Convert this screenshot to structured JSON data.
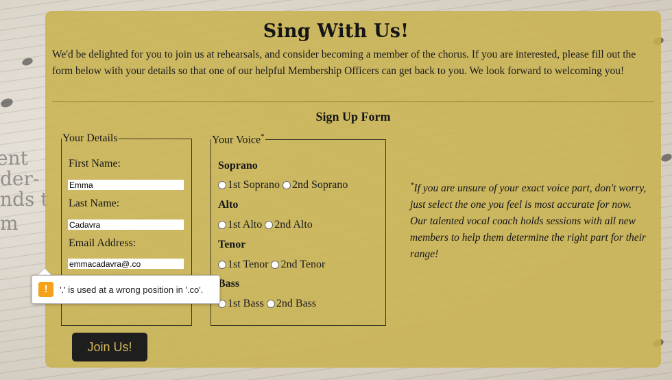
{
  "page": {
    "title": "Sing With Us!",
    "intro": "We'd be delighted for you to join us at rehearsals, and consider becoming a member of the chorus. If you are interested, please fill out the form below with your details so that one of our helpful Membership Officers can get back to you. We look forward to welcoming you!"
  },
  "form": {
    "title": "Sign Up Form",
    "details_legend": "Your Details",
    "first_name_label": "First Name:",
    "first_name_value": "Emma",
    "last_name_label": "Last Name:",
    "last_name_value": "Cadavra",
    "email_label": "Email Address:",
    "email_value": "emmacadavra@.co",
    "voice_legend": "Your Voice",
    "voice_asterisk": "*",
    "groups": [
      {
        "label": "Soprano",
        "options": [
          "1st Soprano",
          "2nd Soprano"
        ]
      },
      {
        "label": "Alto",
        "options": [
          "1st Alto",
          "2nd Alto"
        ]
      },
      {
        "label": "Tenor",
        "options": [
          "1st Tenor",
          "2nd Tenor"
        ]
      },
      {
        "label": "Bass",
        "options": [
          "1st Bass",
          "2nd Bass"
        ]
      }
    ],
    "note_asterisk": "*",
    "note": "If you are unsure of your exact voice part, don't worry, just select the one you feel is most accurate for now. Our talented vocal coach holds sessions with all new members to help them determine the right part for their range!",
    "submit_label": "Join Us!"
  },
  "validation": {
    "icon": "warning-icon",
    "icon_glyph": "!",
    "message": "'.' is used at a wrong position in '.co'."
  },
  "colors": {
    "card": "#c8b24e",
    "button_bg": "#1e1e1e",
    "button_text": "#d6b85a",
    "warning": "#f6a11a"
  }
}
